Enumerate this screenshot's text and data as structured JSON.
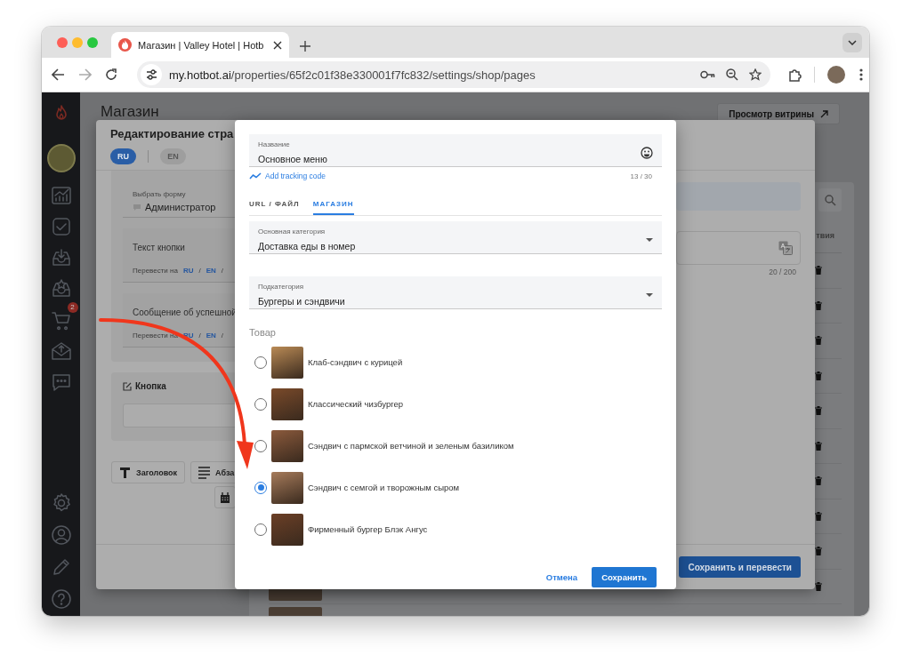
{
  "browser": {
    "tab_title": "Магазин | Valley Hotel | Hotb",
    "url_host": "my.hotbot.ai",
    "url_path": "/properties/65f2c01f38e330001f7fc832/settings/shop/pages"
  },
  "sidebar": {
    "cart_badge": "2"
  },
  "page": {
    "title": "Магазин",
    "storefront_button": "Просмотр витрины",
    "table": {
      "column_header": "твия"
    }
  },
  "page_editor": {
    "title": "Редактирование стра",
    "languages": [
      {
        "label": "RU",
        "selected": true
      },
      {
        "label": "EN",
        "selected": false
      }
    ],
    "form_field": {
      "label": "Выбрать форму",
      "value": "Администратор"
    },
    "text_fields": [
      {
        "label": "Текст кнопки",
        "translate": {
          "label": "Перевести на",
          "links": [
            "RU",
            "EN"
          ],
          "separator": "/"
        }
      },
      {
        "label": "Сообщение об успешной",
        "translate": {
          "label": "Перевести на",
          "links": [
            "RU",
            "EN"
          ],
          "separator": "/"
        }
      }
    ],
    "button_section": {
      "title": "Кнопка"
    },
    "toolbar": [
      {
        "kind": "heading",
        "label": "Заголовок"
      },
      {
        "kind": "paragraph",
        "label": "Абза"
      },
      {
        "kind": "date"
      }
    ],
    "translate_counter": "20 / 200",
    "save_translate_button": "Сохранить и перевести"
  },
  "dialog": {
    "name_field": {
      "label": "Название",
      "value": "Основное меню",
      "counter": "13 / 30"
    },
    "tracking_link": "Add tracking code",
    "tabs": [
      {
        "label": "URL / ФАЙЛ",
        "selected": false
      },
      {
        "label": "МАГАЗИН",
        "selected": true
      }
    ],
    "category": {
      "label": "Основная категория",
      "value": "Доставка еды в номер"
    },
    "subcategory": {
      "label": "Подкатегория",
      "value": "Бургеры и сэндвичи"
    },
    "products_label": "Товар",
    "products": [
      {
        "name": "Клаб-сэндвич с курицей",
        "selected": false
      },
      {
        "name": "Классический чизбургер",
        "selected": false
      },
      {
        "name": "Сэндвич с пармской ветчиной и зеленым базиликом",
        "selected": false
      },
      {
        "name": "Сэндвич с семгой и творожным сыром",
        "selected": true
      },
      {
        "name": "Фирменный бургер Блэк Ангус",
        "selected": false
      }
    ],
    "cancel_button": "Отмена",
    "save_button": "Сохранить"
  }
}
